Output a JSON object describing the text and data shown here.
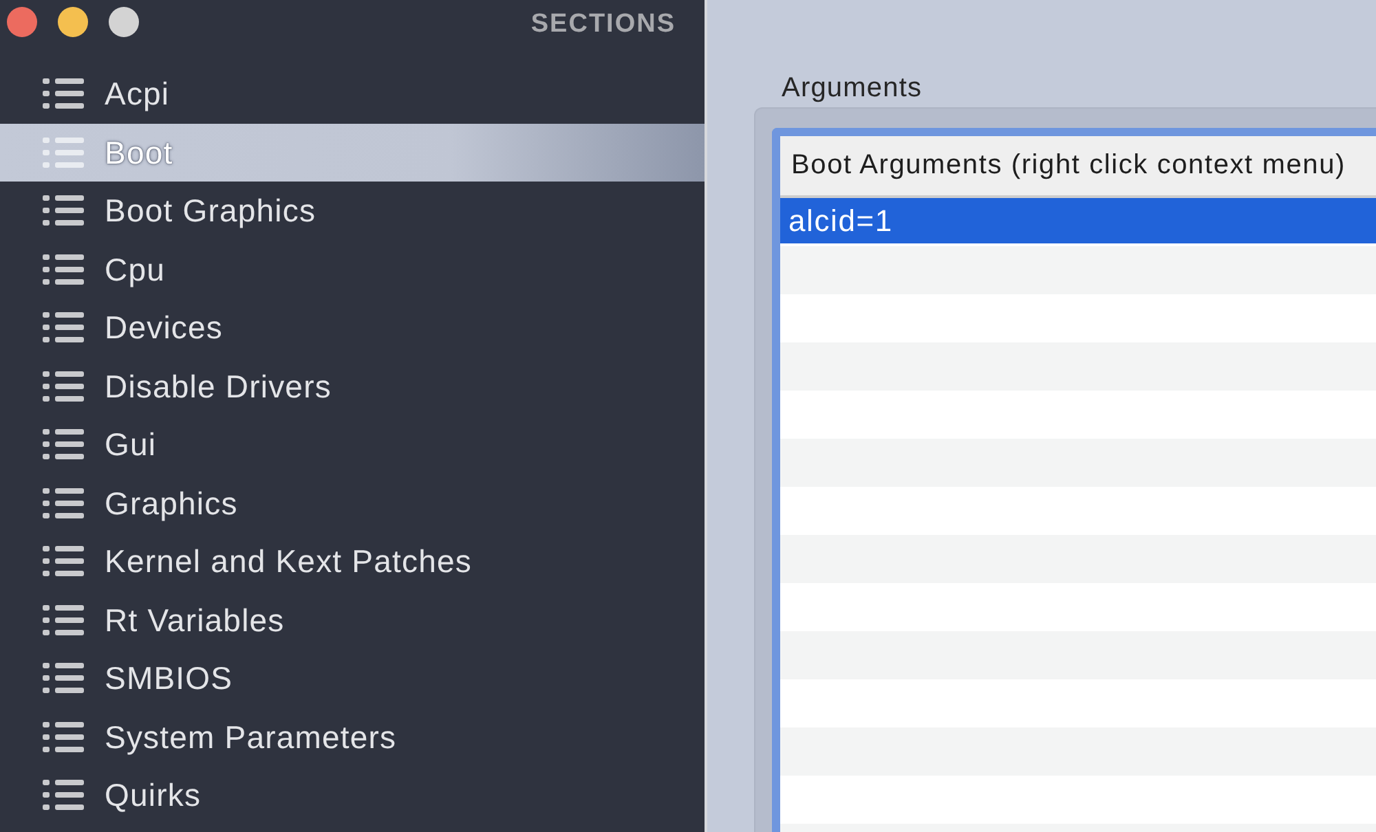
{
  "window": {
    "controls": [
      {
        "color": "#ec6b5f"
      },
      {
        "color": "#f4bf4f"
      },
      {
        "color": "#d3d3d3"
      }
    ]
  },
  "sidebar": {
    "title": "SECTIONS",
    "items": [
      {
        "label": "Acpi",
        "selected": false
      },
      {
        "label": "Boot",
        "selected": true
      },
      {
        "label": "Boot Graphics",
        "selected": false
      },
      {
        "label": "Cpu",
        "selected": false
      },
      {
        "label": "Devices",
        "selected": false
      },
      {
        "label": "Disable Drivers",
        "selected": false
      },
      {
        "label": "Gui",
        "selected": false
      },
      {
        "label": "Graphics",
        "selected": false
      },
      {
        "label": "Kernel and Kext Patches",
        "selected": false
      },
      {
        "label": "Rt Variables",
        "selected": false
      },
      {
        "label": "SMBIOS",
        "selected": false
      },
      {
        "label": "System Parameters",
        "selected": false
      },
      {
        "label": "Quirks",
        "selected": false
      }
    ]
  },
  "arguments": {
    "label": "Arguments",
    "table": {
      "columns": [
        "Boot Arguments (right click context menu)"
      ],
      "rows": [
        {
          "cells": [
            "alcid=1"
          ],
          "selected": true
        }
      ]
    }
  }
}
